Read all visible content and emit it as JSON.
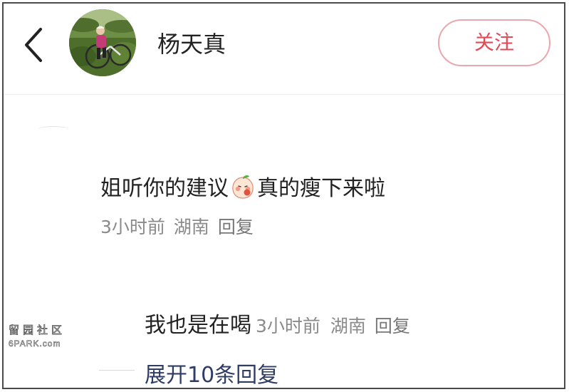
{
  "header": {
    "username": "杨天真",
    "follow_label": "关注"
  },
  "icons": {
    "back": "chevron-left-icon",
    "emoji": "shy-peach-emoji-icon"
  },
  "colors": {
    "follow_text": "#e24a56",
    "follow_border": "#e9a7ad",
    "expand_link": "#2f3d66",
    "meta_text": "#8a8a8a"
  },
  "comment": {
    "text_before": "姐听你的建议",
    "text_after": "真的瘦下来啦",
    "time": "3小时前",
    "location": "湖南",
    "reply_label": "回复"
  },
  "sub_reply": {
    "text": "我也是在喝",
    "time": "3小时前",
    "location": "湖南",
    "reply_label": "回复"
  },
  "expand_label": "展开10条回复",
  "watermark": {
    "cn": "留园社区",
    "en": "6PARK.com"
  }
}
